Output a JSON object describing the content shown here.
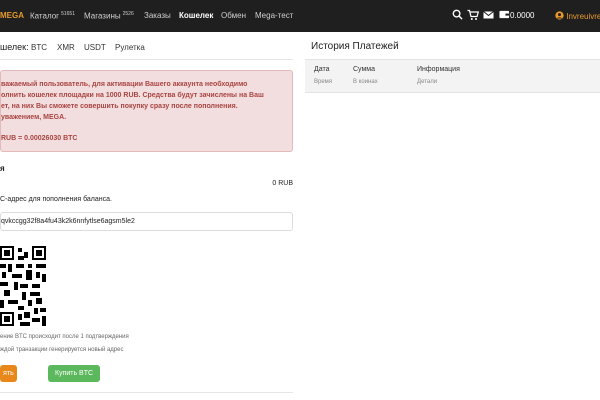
{
  "topbar": {
    "brand": "MEGA",
    "nav": [
      {
        "label": "Каталог",
        "badge": "51651"
      },
      {
        "label": "Магазины",
        "badge": "2526"
      },
      {
        "label": "Заказы",
        "badge": ""
      },
      {
        "label": "Кошелек",
        "badge": ""
      },
      {
        "label": "Обмен",
        "badge": ""
      },
      {
        "label": "Mega-тест",
        "badge": ""
      }
    ],
    "balance": "0.0000",
    "username": "Invreuivrenbt",
    "icons": [
      "search-icon",
      "cart-icon",
      "mail-icon",
      "wallet-icon",
      "user-icon"
    ]
  },
  "wallet": {
    "heading": "шелек:",
    "tabs": [
      "BTC",
      "XMR",
      "USDT",
      "Рулетка"
    ],
    "alert_lines": [
      "важаемый пользователь, для активации Вашего аккаунта необходимо",
      "олнить кошелек площадки на 1000 RUB. Средства будут зачислены на Ваш",
      "ет, на них Вы сможете совершить покупку сразу после пополнения.",
      "уважением, MEGA."
    ],
    "rate": "RUB = 0.00026030 BTC",
    "section_title": "я",
    "balance_value": "0 RUB",
    "instruction": "С-адрес для пополнения баланса.",
    "address": "qvkccgg32f8a4fu43k2k6nnfytlse6agsm5le2",
    "note1": "ение BTC происходит после 1 подтверждения",
    "note2": "ждой транзакции генерируется новый адрес",
    "button_left": "ять",
    "button_buy": "Купить BTC"
  },
  "history": {
    "title": "История Платежей",
    "columns": [
      {
        "header": "Дата",
        "sub": "Время"
      },
      {
        "header": "Сумма",
        "sub": "В коинах"
      },
      {
        "header": "Информация",
        "sub": "Детали"
      }
    ]
  },
  "colors": {
    "topbar_bg": "#1f1f1f",
    "accent": "#e89a2c",
    "alert_bg": "#f2dede",
    "alert_text": "#a94442",
    "buy_button": "#5cb85c",
    "orange_button": "#e8881a"
  }
}
